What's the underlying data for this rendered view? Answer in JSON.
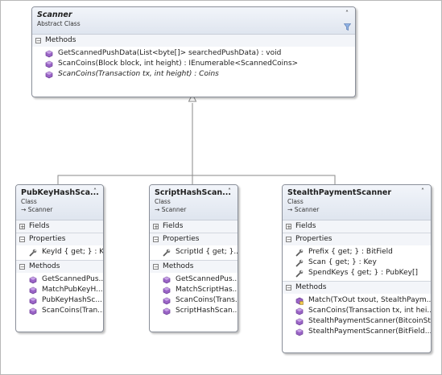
{
  "classes": {
    "scanner": {
      "title": "Scanner",
      "subtitle": "Abstract Class",
      "section": "Methods",
      "members": [
        "GetScannedPushData(List<byte[]> searchedPushData) : void",
        "ScanCoins(Block block, int height) : IEnumerable<ScannedCoins>",
        "ScanCoins(Transaction tx, int height) : Coins"
      ]
    },
    "pubkeyhash": {
      "title": "PubKeyHashSca...",
      "subtitle": "Class",
      "base": "Scanner",
      "fields": "Fields",
      "properties": "Properties",
      "props": [
        "KeyId { get; } : K..."
      ],
      "methods": "Methods",
      "members": [
        "GetScannedPus...",
        "MatchPubKeyH...",
        "PubKeyHashSc...",
        "ScanCoins(Tran..."
      ]
    },
    "scripthash": {
      "title": "ScriptHashScan...",
      "subtitle": "Class",
      "base": "Scanner",
      "fields": "Fields",
      "properties": "Properties",
      "props": [
        "ScriptId { get; }..."
      ],
      "methods": "Methods",
      "members": [
        "GetScannedPus...",
        "MatchScriptHas...",
        "ScanCoins(Trans...",
        "ScriptHashScan..."
      ]
    },
    "stealth": {
      "title": "StealthPaymentScanner",
      "subtitle": "Class",
      "base": "Scanner",
      "fields": "Fields",
      "properties": "Properties",
      "props": [
        "Prefix { get; } : BitField",
        "Scan { get; } : Key",
        "SpendKeys { get; } : PubKey[]"
      ],
      "methods": "Methods",
      "members": [
        "Match(TxOut txout, StealthPaym...",
        "ScanCoins(Transaction tx, int hei...",
        "StealthPaymentScanner(BitcoinSt...",
        "StealthPaymentScanner(BitField..."
      ]
    }
  },
  "colors": {
    "method": "#8f5bb8",
    "property": "#3a3a3a",
    "border": "#8a8f99"
  },
  "icons": {
    "collapse": "double-chevron-up-icon",
    "expand": "plus-icon",
    "collapse_section": "minus-icon",
    "inherit": "arrow-icon",
    "filter": "filter-icon"
  }
}
